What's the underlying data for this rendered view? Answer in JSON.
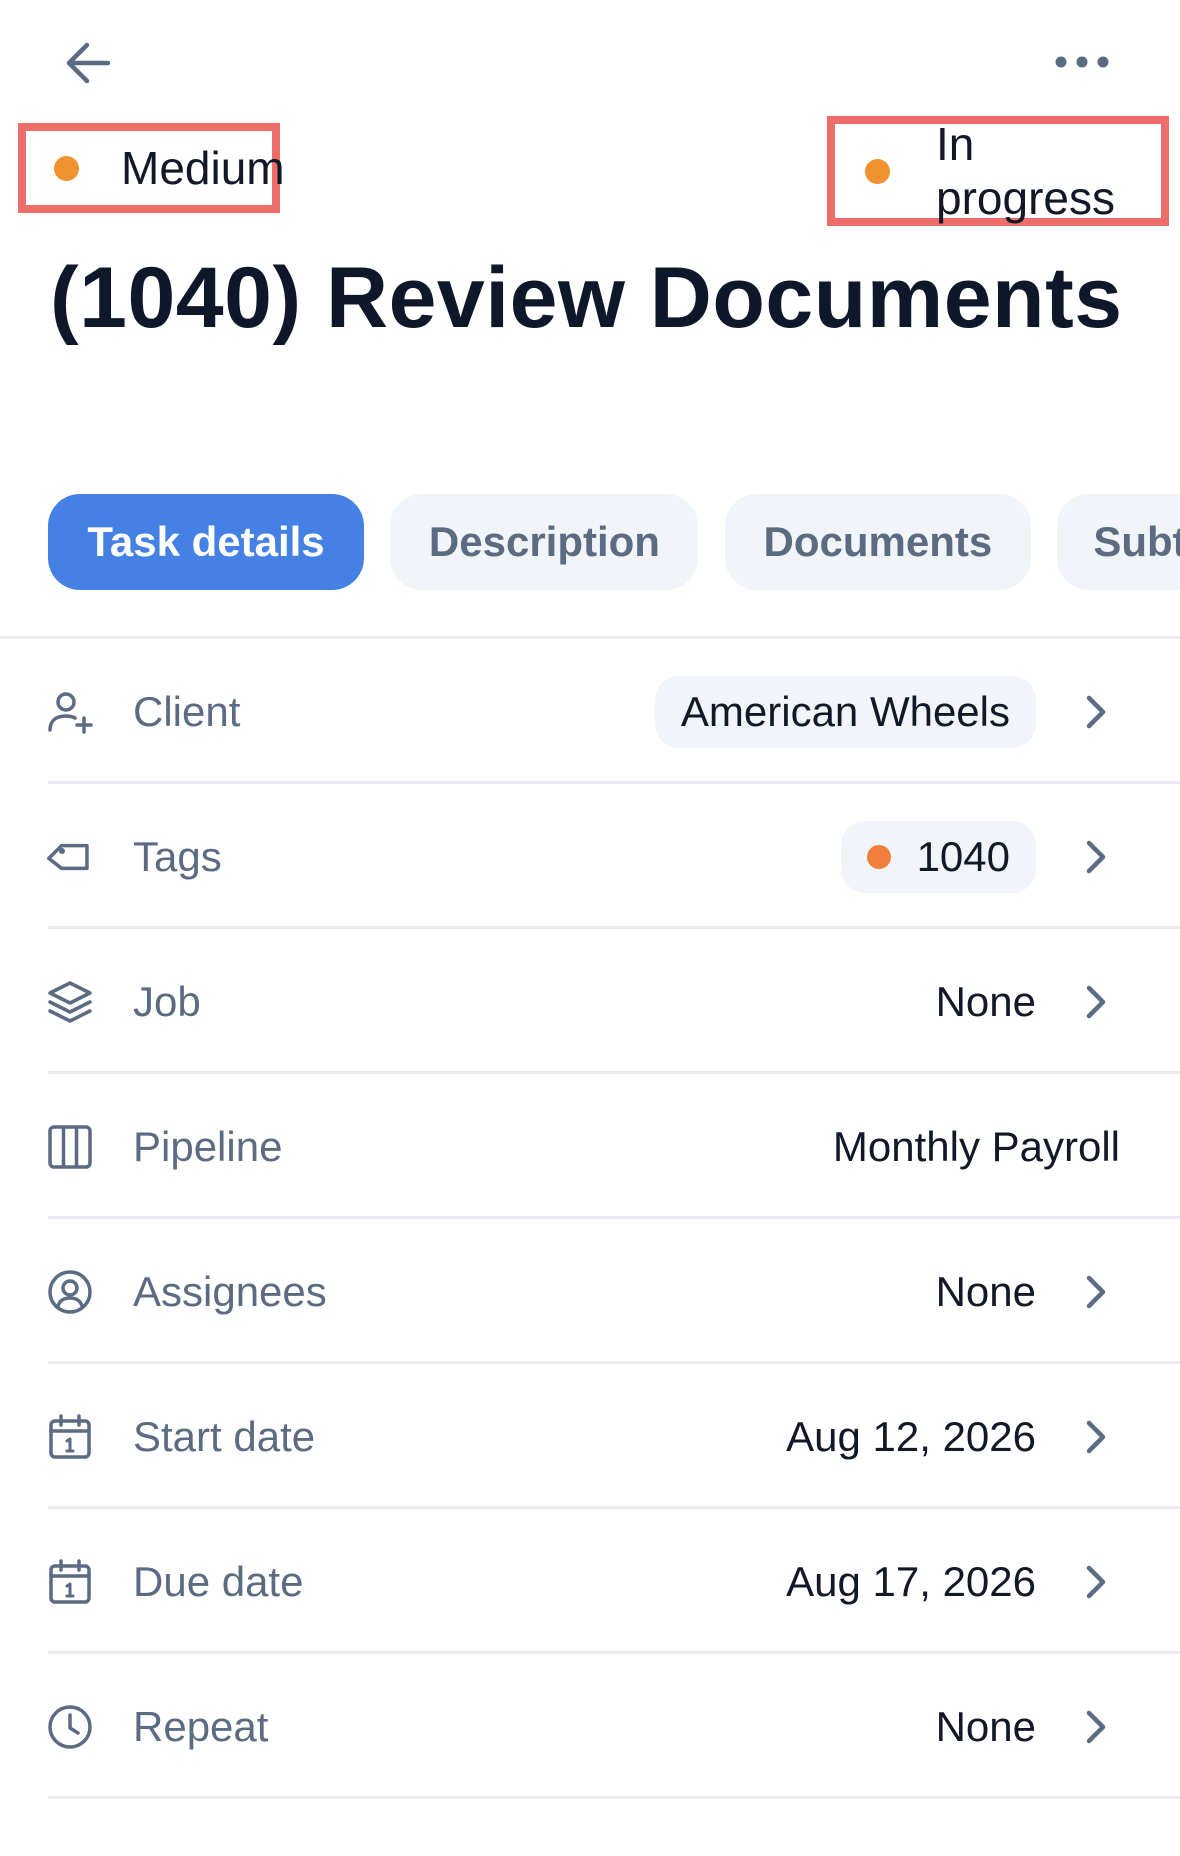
{
  "header": {
    "back_icon": "arrow-left-icon",
    "more_icon": "more-horizontal-icon"
  },
  "priority": {
    "label": "Medium",
    "dot_color": "#f0922f"
  },
  "status": {
    "label": "In progress",
    "dot_color": "#f0922f"
  },
  "task": {
    "title": "(1040) Review Documents"
  },
  "tabs": [
    {
      "label": "Task details",
      "active": true
    },
    {
      "label": "Description",
      "active": false
    },
    {
      "label": "Documents",
      "active": false
    },
    {
      "label": "Subt",
      "active": false
    }
  ],
  "fields": {
    "client": {
      "label": "Client",
      "value": "American Wheels",
      "icon": "user-plus-icon"
    },
    "tags": {
      "label": "Tags",
      "value": "1040",
      "tag_color": "#ef7f3b",
      "icon": "tag-icon"
    },
    "job": {
      "label": "Job",
      "value": "None",
      "icon": "layers-icon"
    },
    "pipeline": {
      "label": "Pipeline",
      "value": "Monthly Payroll",
      "icon": "columns-icon"
    },
    "assignees": {
      "label": "Assignees",
      "value": "None",
      "icon": "user-circle-icon"
    },
    "start_date": {
      "label": "Start date",
      "value": "Aug 12, 2026",
      "icon": "calendar-icon"
    },
    "due_date": {
      "label": "Due date",
      "value": "Aug 17, 2026",
      "icon": "calendar-icon"
    },
    "repeat": {
      "label": "Repeat",
      "value": "None",
      "icon": "clock-icon"
    }
  },
  "colors": {
    "accent": "#4581e4",
    "highlight_border": "#ec6d69",
    "label_gray": "#5b6b82"
  }
}
